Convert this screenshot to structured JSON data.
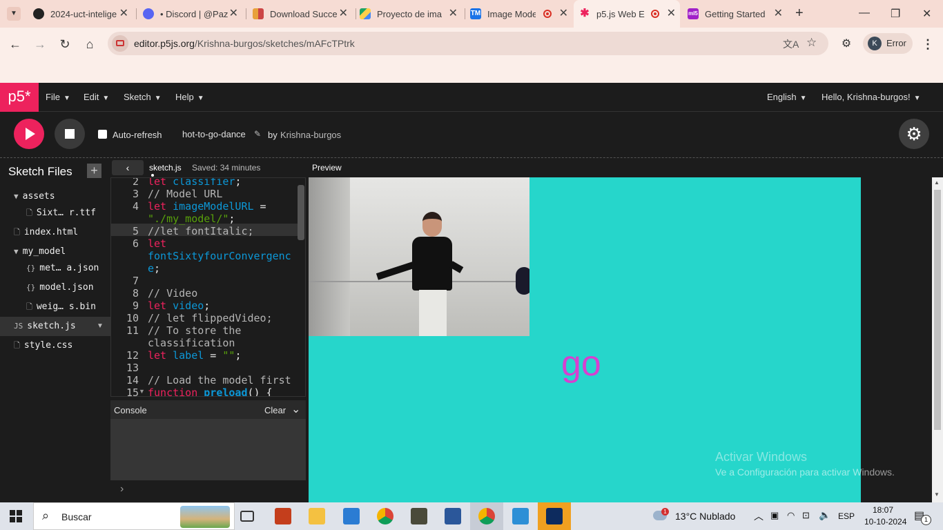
{
  "browser": {
    "tabs": [
      {
        "title": "2024-uct-intelige",
        "icon": "github-icon"
      },
      {
        "title": "• Discord | @Paz",
        "icon": "discord-icon"
      },
      {
        "title": "Download Succe",
        "icon": "download-icon"
      },
      {
        "title": "Proyecto de ima",
        "icon": "drive-icon"
      },
      {
        "title": "Image Mode",
        "icon": "teachable-machine-icon"
      },
      {
        "title": "p5.js Web Ed",
        "icon": "p5-icon",
        "active": true
      },
      {
        "title": "Getting Started",
        "icon": "ml5-icon"
      }
    ],
    "url_host": "editor.p5js.org",
    "url_path": "/Krishna-burgos/sketches/mAFcTPtrk",
    "profile_letter": "K",
    "profile_label": "Error"
  },
  "p5": {
    "logo": "p5*",
    "menus": [
      "File",
      "Edit",
      "Sketch",
      "Help"
    ],
    "language": "English",
    "greeting": "Hello, Krishna-burgos!",
    "auto_refresh": "Auto-refresh",
    "sketch_name": "hot-to-go-dance",
    "by": "by",
    "author": "Krishna-burgos",
    "sidebar_title": "Sketch Files",
    "files": [
      {
        "name": "assets",
        "type": "folder"
      },
      {
        "name": "Sixt… r.ttf",
        "type": "file"
      },
      {
        "name": "index.html",
        "type": "file"
      },
      {
        "name": "my_model",
        "type": "folder"
      },
      {
        "name": "met… a.json",
        "type": "json"
      },
      {
        "name": "model.json",
        "type": "json"
      },
      {
        "name": "weig… s.bin",
        "type": "file"
      },
      {
        "name": "sketch.js",
        "type": "js"
      },
      {
        "name": "style.css",
        "type": "file"
      }
    ],
    "editor_file": "sketch.js",
    "saved": "Saved: 34 minutes",
    "line_numbers": [
      "2",
      "3",
      "4",
      "",
      "5",
      "6",
      "",
      "",
      "7",
      "8",
      "9",
      "10",
      "11",
      "",
      "12",
      "13",
      "14",
      "15"
    ],
    "console_label": "Console",
    "console_clear": "Clear",
    "console_prompt": "›",
    "preview_label": "Preview",
    "canvas_text": "go"
  },
  "colors": {
    "p5_pink": "#ed225d",
    "canvas_bg": "#26d6cb",
    "go_text": "#d73fd0"
  },
  "os": {
    "watermark_title": "Activar Windows",
    "watermark_sub": "Ve a Configuración para activar Windows.",
    "search_placeholder": "Buscar",
    "weather": "13°C  Nublado",
    "language": "ESP",
    "time": "18:07",
    "date": "10-10-2024",
    "notif_count": "1",
    "weather_badge": "1"
  }
}
